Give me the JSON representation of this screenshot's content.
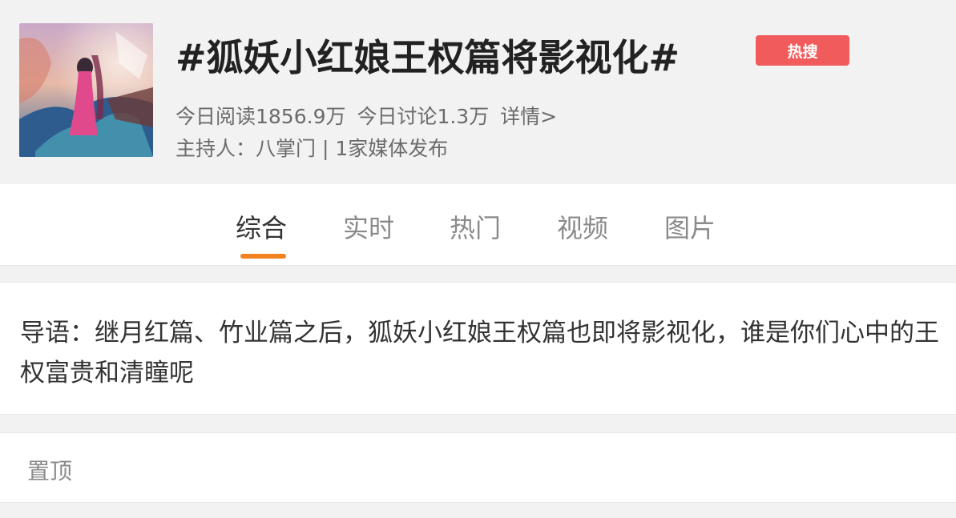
{
  "header": {
    "title": "#狐妖小红娘王权篇将影视化#",
    "badge": "热搜",
    "stats": {
      "read": "今日阅读1856.9万",
      "discuss": "今日讨论1.3万",
      "details": "详情>"
    },
    "host": "主持人：八掌门 | 1家媒体发布",
    "cover_icon": "topic-cover-illustration"
  },
  "tabs": [
    {
      "label": "综合",
      "active": true
    },
    {
      "label": "实时",
      "active": false
    },
    {
      "label": "热门",
      "active": false
    },
    {
      "label": "视频",
      "active": false
    },
    {
      "label": "图片",
      "active": false
    }
  ],
  "guide": {
    "text": "导语：继月红篇、竹业篇之后，狐妖小红娘王权篇也即将影视化，谁是你们心中的王权富贵和清瞳呢"
  },
  "pinned": {
    "label": "置顶"
  },
  "colors": {
    "badge": "#f15b5b",
    "accent": "#f08220",
    "background": "#f2f2f2"
  }
}
